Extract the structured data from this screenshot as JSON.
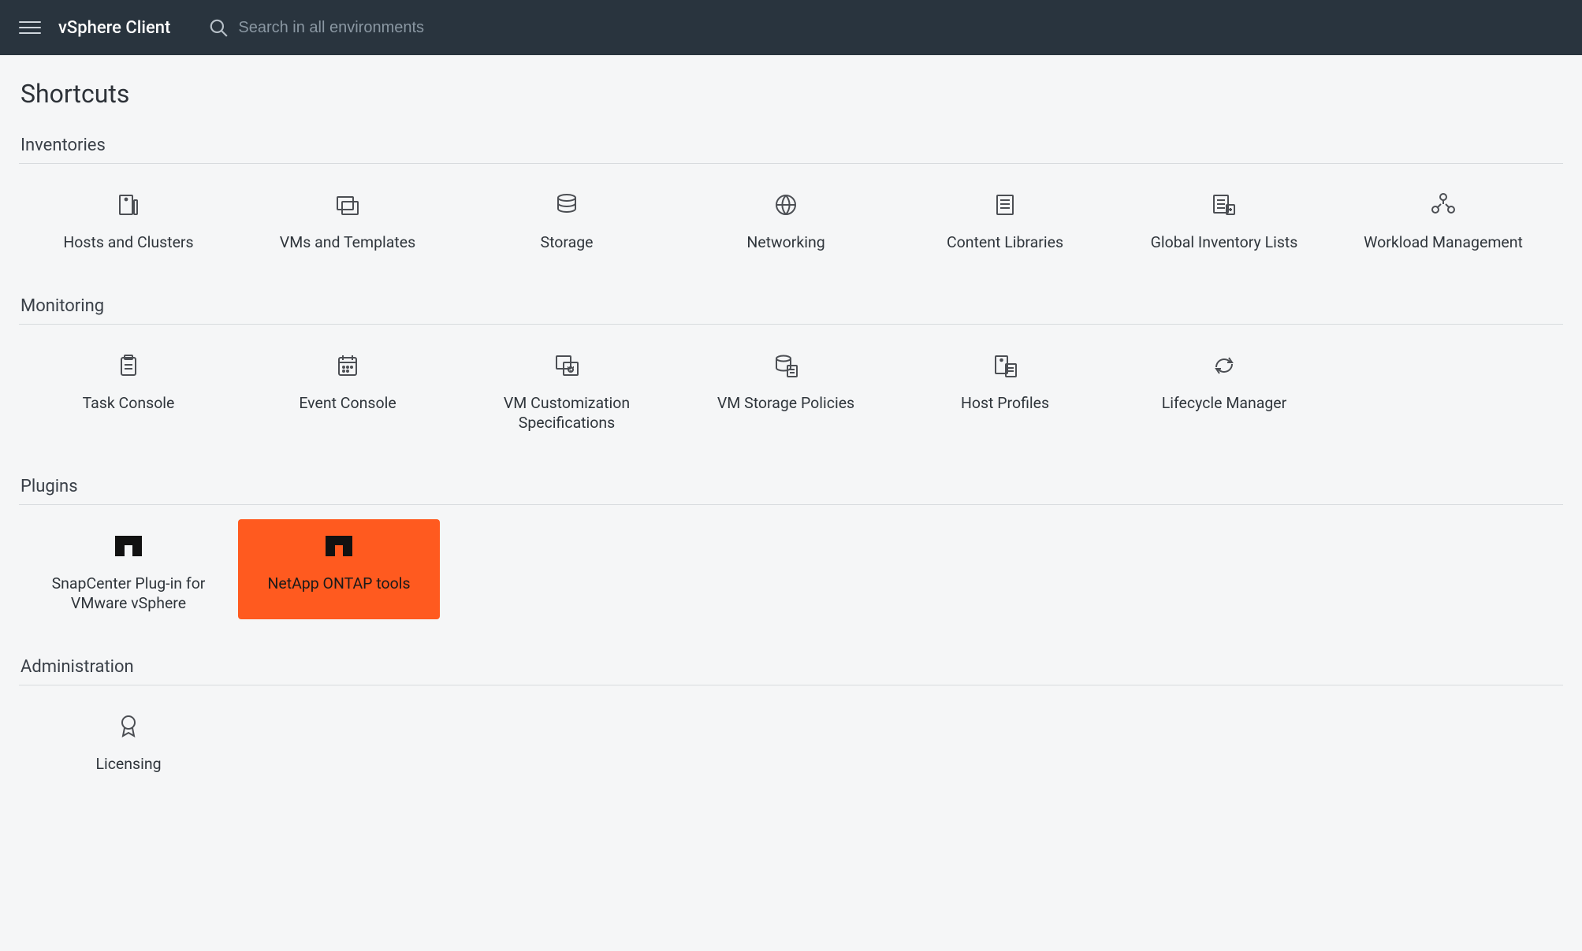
{
  "header": {
    "brand": "vSphere Client",
    "search_placeholder": "Search in all environments"
  },
  "page": {
    "title": "Shortcuts"
  },
  "sections": {
    "inventories": {
      "title": "Inventories",
      "items": [
        {
          "label": "Hosts and Clusters",
          "icon": "hosts-clusters-icon"
        },
        {
          "label": "VMs and Templates",
          "icon": "vms-templates-icon"
        },
        {
          "label": "Storage",
          "icon": "storage-icon"
        },
        {
          "label": "Networking",
          "icon": "networking-icon"
        },
        {
          "label": "Content Libraries",
          "icon": "content-libraries-icon"
        },
        {
          "label": "Global Inventory Lists",
          "icon": "global-inventory-icon"
        },
        {
          "label": "Workload Management",
          "icon": "workload-management-icon"
        }
      ]
    },
    "monitoring": {
      "title": "Monitoring",
      "items": [
        {
          "label": "Task Console",
          "icon": "task-console-icon"
        },
        {
          "label": "Event Console",
          "icon": "event-console-icon"
        },
        {
          "label": "VM Customization Specifications",
          "icon": "vm-customization-icon"
        },
        {
          "label": "VM Storage Policies",
          "icon": "vm-storage-policies-icon"
        },
        {
          "label": "Host Profiles",
          "icon": "host-profiles-icon"
        },
        {
          "label": "Lifecycle Manager",
          "icon": "lifecycle-manager-icon"
        }
      ]
    },
    "plugins": {
      "title": "Plugins",
      "items": [
        {
          "label": "SnapCenter Plug-in for VMware vSphere",
          "icon": "netapp-icon"
        },
        {
          "label": "NetApp ONTAP tools",
          "icon": "netapp-icon",
          "highlight": true
        }
      ]
    },
    "administration": {
      "title": "Administration",
      "items": [
        {
          "label": "Licensing",
          "icon": "licensing-icon"
        }
      ]
    }
  }
}
